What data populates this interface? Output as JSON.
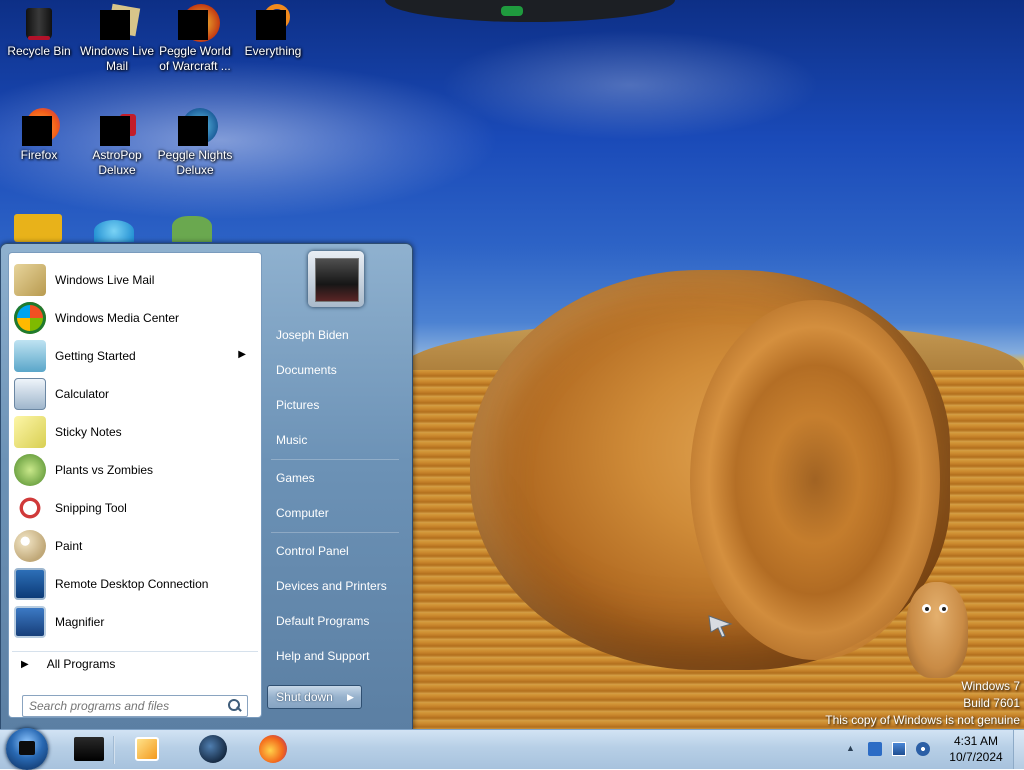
{
  "desktop": {
    "icons": [
      {
        "label": "Recycle Bin",
        "icon": "recycle-bin-icon"
      },
      {
        "label": "Windows Live Mail",
        "icon": "windows-live-mail-icon"
      },
      {
        "label": "Peggle World of Warcraft ...",
        "icon": "peggle-wow-icon"
      },
      {
        "label": "Everything",
        "icon": "everything-search-icon"
      },
      {
        "label": "Firefox",
        "icon": "firefox-icon"
      },
      {
        "label": "AstroPop Deluxe",
        "icon": "astropop-icon"
      },
      {
        "label": "Peggle Nights Deluxe",
        "icon": "peggle-nights-icon"
      }
    ]
  },
  "watermark": {
    "line1": "Windows 7",
    "line2": "Build 7601",
    "line3": "This copy of Windows is not genuine"
  },
  "start_menu": {
    "programs": [
      {
        "label": "Windows Live Mail",
        "icon": "windows-live-mail-icon"
      },
      {
        "label": "Windows Media Center",
        "icon": "windows-media-center-icon"
      },
      {
        "label": "Getting Started",
        "icon": "getting-started-icon",
        "has_submenu": true
      },
      {
        "label": "Calculator",
        "icon": "calculator-icon"
      },
      {
        "label": "Sticky Notes",
        "icon": "sticky-notes-icon"
      },
      {
        "label": "Plants vs Zombies",
        "icon": "plants-vs-zombies-icon"
      },
      {
        "label": "Snipping Tool",
        "icon": "snipping-tool-icon"
      },
      {
        "label": "Paint",
        "icon": "paint-icon"
      },
      {
        "label": "Remote Desktop Connection",
        "icon": "remote-desktop-icon"
      },
      {
        "label": "Magnifier",
        "icon": "magnifier-icon"
      }
    ],
    "all_programs": "All Programs",
    "search_placeholder": "Search programs and files",
    "right_items": [
      "Joseph Biden",
      "Documents",
      "Pictures",
      "Music",
      "Games",
      "Computer",
      "Control Panel",
      "Devices and Printers",
      "Default Programs",
      "Help and Support"
    ],
    "shutdown_label": "Shut down"
  },
  "taskbar": {
    "pinned": [
      {
        "name": "taskbar-app-1",
        "icon": "black-app-icon"
      },
      {
        "name": "taskbar-media-player",
        "icon": "windows-media-player-icon"
      },
      {
        "name": "taskbar-globe-app",
        "icon": "globe-icon"
      },
      {
        "name": "taskbar-firefox",
        "icon": "firefox-icon"
      }
    ],
    "clock_time": "4:31 AM",
    "clock_date": "10/7/2024"
  },
  "colors": {
    "start_menu_blue": "#6c92b6",
    "taskbar": "#b7cfe6",
    "accent_sky": "#1a4ab8"
  }
}
